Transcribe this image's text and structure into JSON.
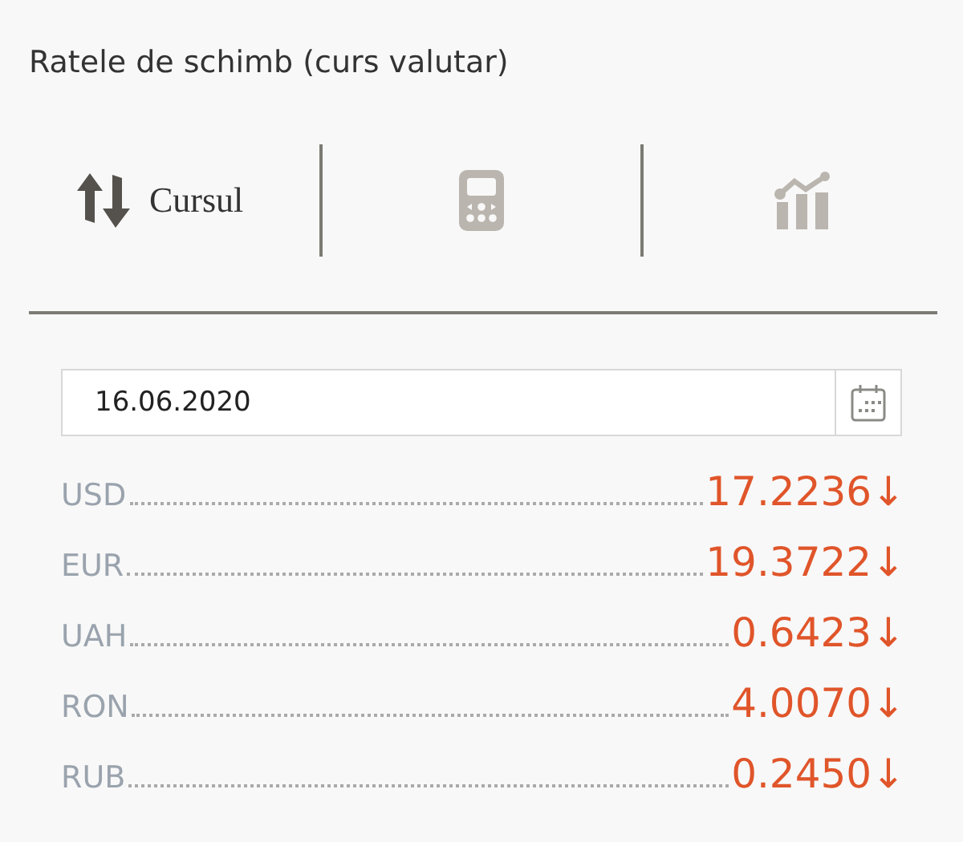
{
  "title": "Ratele de schimb (curs valutar)",
  "tabs": [
    {
      "kind": "exchange",
      "label": "Cursul",
      "selected": true
    },
    {
      "kind": "calculator",
      "selected": false
    },
    {
      "kind": "chart",
      "selected": false
    }
  ],
  "date_field": {
    "value": "16.06.2020"
  },
  "rates": [
    {
      "currency": "USD",
      "value": "17.2236",
      "arrow": "↓"
    },
    {
      "currency": "EUR",
      "value": "19.3722",
      "arrow": "↓"
    },
    {
      "currency": "UAH",
      "value": "0.6423",
      "arrow": "↓"
    },
    {
      "currency": "RON",
      "value": "4.0070",
      "arrow": "↓"
    },
    {
      "currency": "RUB",
      "value": "0.2450",
      "arrow": "↓"
    }
  ]
}
